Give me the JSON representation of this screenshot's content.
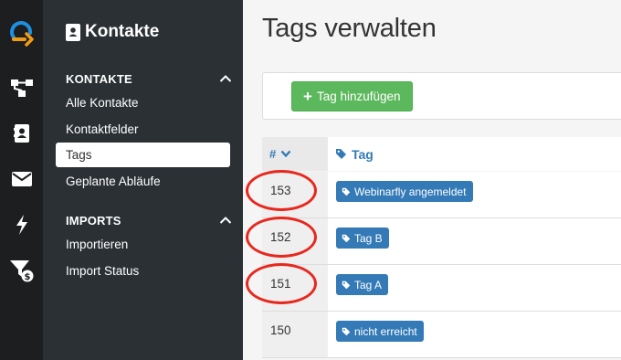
{
  "rail": {
    "items": [
      {
        "icon": "logo-icon"
      },
      {
        "icon": "flow-icon"
      },
      {
        "icon": "contacts-book-icon"
      },
      {
        "icon": "envelope-icon"
      },
      {
        "icon": "lightning-icon"
      },
      {
        "icon": "funnel-dollar-icon"
      }
    ]
  },
  "sidebar": {
    "title": "Kontakte",
    "sections": [
      {
        "label": "KONTAKTE",
        "items": [
          {
            "label": "Alle Kontakte",
            "active": false
          },
          {
            "label": "Kontaktfelder",
            "active": false
          },
          {
            "label": "Tags",
            "active": true
          },
          {
            "label": "Geplante Abläufe",
            "active": false
          }
        ]
      },
      {
        "label": "IMPORTS",
        "items": [
          {
            "label": "Importieren",
            "active": false
          },
          {
            "label": "Import Status",
            "active": false
          }
        ]
      }
    ]
  },
  "main": {
    "title": "Tags verwalten",
    "add_button": "Tag hinzufügen",
    "table": {
      "col_num": "#",
      "col_tag": "Tag",
      "rows": [
        {
          "id": "153",
          "tag": "Webinarfly angemeldet",
          "highlighted": true
        },
        {
          "id": "152",
          "tag": "Tag B",
          "highlighted": true
        },
        {
          "id": "151",
          "tag": "Tag A",
          "highlighted": true
        },
        {
          "id": "150",
          "tag": "nicht erreicht",
          "highlighted": false
        }
      ]
    }
  },
  "colors": {
    "rail_bg": "#1c1e20",
    "sidebar_bg": "#2b3034",
    "accent_blue": "#337ab7",
    "success_green": "#5cb85c",
    "highlight_red": "#e8281e",
    "logo_blue": "#1e90e0",
    "logo_orange": "#f39c12"
  }
}
